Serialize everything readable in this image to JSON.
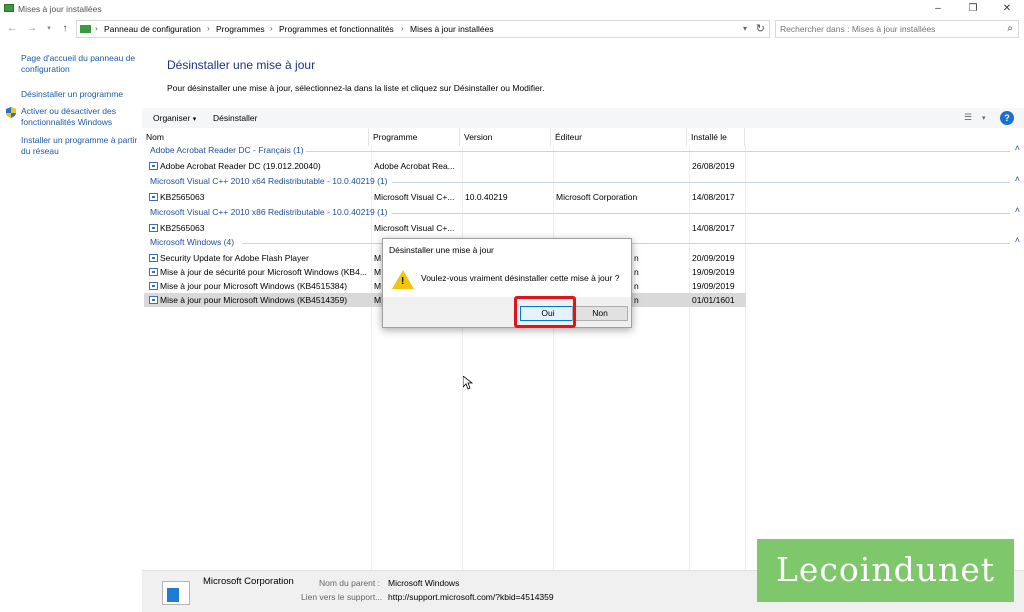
{
  "window": {
    "title": "Mises à jour installées",
    "minimize": "–",
    "restore": "❐",
    "close": "✕"
  },
  "address": {
    "crumbs": [
      "Panneau de configuration",
      "Programmes",
      "Programmes et fonctionnalités",
      "Mises à jour installées"
    ],
    "search_placeholder": "Rechercher dans : Mises à jour installées"
  },
  "sidebar": {
    "items": [
      {
        "label": "Page d'accueil du panneau de configuration"
      },
      {
        "label": "Désinstaller un programme"
      },
      {
        "label": "Activer ou désactiver des fonctionnalités Windows"
      },
      {
        "label": "Installer un programme à partir du réseau"
      }
    ]
  },
  "main": {
    "title": "Désinstaller une mise à jour",
    "description": "Pour désinstaller une mise à jour, sélectionnez-la dans la liste et cliquez sur Désinstaller ou Modifier."
  },
  "toolbar": {
    "organize": "Organiser",
    "uninstall": "Désinstaller",
    "help": "?"
  },
  "columns": {
    "name": "Nom",
    "program": "Programme",
    "version": "Version",
    "publisher": "Éditeur",
    "installed": "Installé le"
  },
  "groups": [
    {
      "label": "Adobe Acrobat Reader DC - Français (1)"
    },
    {
      "label": "Microsoft Visual C++ 2010  x64 Redistributable - 10.0.40219 (1)"
    },
    {
      "label": "Microsoft Visual C++ 2010  x86 Redistributable - 10.0.40219 (1)"
    },
    {
      "label": "Microsoft Windows (4)"
    }
  ],
  "rows": [
    {
      "name": "Adobe Acrobat Reader DC  (19.012.20040)",
      "program": "Adobe Acrobat Rea...",
      "version": "",
      "publisher": "",
      "installed": "26/08/2019"
    },
    {
      "name": "KB2565063",
      "program": "Microsoft Visual C+...",
      "version": "10.0.40219",
      "publisher": "Microsoft Corporation",
      "installed": "14/08/2017"
    },
    {
      "name": "KB2565063",
      "program": "Microsoft Visual C+...",
      "version": "",
      "publisher": "",
      "installed": "14/08/2017"
    },
    {
      "name": "Security Update for Adobe Flash Player",
      "program": "M",
      "version": "",
      "publisher": "n",
      "installed": "20/09/2019"
    },
    {
      "name": "Mise à jour de sécurité pour Microsoft Windows (KB4...",
      "program": "M",
      "version": "",
      "publisher": "n",
      "installed": "19/09/2019"
    },
    {
      "name": "Mise à jour pour Microsoft Windows (KB4515384)",
      "program": "M",
      "version": "",
      "publisher": "n",
      "installed": "19/09/2019"
    },
    {
      "name": "Mise à jour pour Microsoft Windows (KB4514359)",
      "program": "M",
      "version": "",
      "publisher": "n",
      "installed": "01/01/1601"
    }
  ],
  "dialog": {
    "title": "Désinstaller une mise à jour",
    "message": "Voulez-vous vraiment désinstaller cette mise à jour ?",
    "yes": "Oui",
    "no": "Non"
  },
  "details": {
    "publisher": "Microsoft Corporation",
    "parent_label": "Nom du parent :",
    "parent_value": "Microsoft Windows",
    "support_label": "Lien vers le support...",
    "support_value": "http://support.microsoft.com/?kbid=4514359"
  },
  "watermark": {
    "text": "Lecoindunet"
  },
  "colors": {
    "accent": "#1e50a0",
    "highlight": "#e0141c",
    "watermark": "#7ec76a"
  }
}
